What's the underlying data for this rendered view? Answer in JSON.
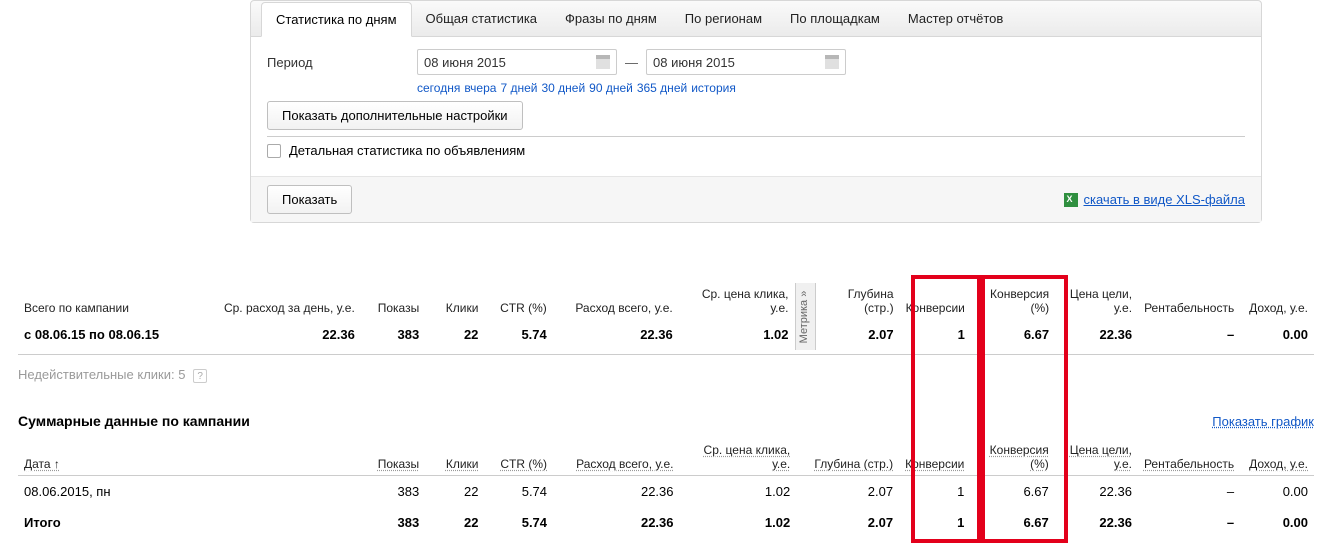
{
  "tabs": {
    "t0": "Статистика по дням",
    "t1": "Общая статистика",
    "t2": "Фразы по дням",
    "t3": "По регионам",
    "t4": "По площадкам",
    "t5": "Мастер отчётов"
  },
  "period": {
    "label": "Период",
    "from": "08 июня 2015",
    "to": "08 июня 2015"
  },
  "quick": {
    "today": "сегодня",
    "yesterday": "вчера",
    "d7": "7 дней",
    "d30": "30 дней",
    "d90": "90 дней",
    "d365": "365 дней",
    "history": "история"
  },
  "buttons": {
    "more_settings": "Показать дополнительные настройки",
    "detailed_checkbox": "Детальная статистика по объявлениям",
    "show": "Показать"
  },
  "xls": {
    "label": "скачать в виде XLS-файла"
  },
  "summary": {
    "row_label": "Всего по кампании",
    "range": "с 08.06.15 по 08.06.15",
    "headers": {
      "avg_spend_day": "Ср. расход за день, у.е.",
      "shows": "Показы",
      "clicks": "Клики",
      "ctr": "CTR (%)",
      "spend_total": "Расход всего, у.е.",
      "avg_cpc": "Ср. цена клика, у.е.",
      "metrica": "Метрика »",
      "depth": "Глубина (стр.)",
      "conversions": "Конверсии",
      "conv_pct": "Конверсия (%)",
      "goal_price": "Цена цели, у.е.",
      "roi": "Рентабельность",
      "revenue": "Доход, у.е."
    },
    "vals": {
      "avg_spend_day": "22.36",
      "shows": "383",
      "clicks": "22",
      "ctr": "5.74",
      "spend_total": "22.36",
      "avg_cpc": "1.02",
      "depth": "2.07",
      "conversions": "1",
      "conv_pct": "6.67",
      "goal_price": "22.36",
      "roi": "–",
      "revenue": "0.00"
    }
  },
  "invalid_clicks": {
    "label": "Недействительные клики:",
    "value": "5"
  },
  "detail": {
    "title": "Суммарные данные по кампании",
    "show_chart": "Показать график",
    "headers": {
      "date": "Дата ↑",
      "shows": "Показы",
      "clicks": "Клики",
      "ctr": "CTR (%)",
      "spend_total": "Расход всего, у.е.",
      "avg_cpc": "Ср. цена клика, у.е.",
      "depth": "Глубина (стр.)",
      "conversions": "Конверсии",
      "conv_pct": "Конверсия (%)",
      "goal_price": "Цена цели, у.е.",
      "roi": "Рентабельность",
      "revenue": "Доход, у.е."
    },
    "row": {
      "date": "08.06.2015, пн",
      "shows": "383",
      "clicks": "22",
      "ctr": "5.74",
      "spend_total": "22.36",
      "avg_cpc": "1.02",
      "depth": "2.07",
      "conversions": "1",
      "conv_pct": "6.67",
      "goal_price": "22.36",
      "roi": "–",
      "revenue": "0.00"
    },
    "totals_label": "Итого",
    "totals": {
      "shows": "383",
      "clicks": "22",
      "ctr": "5.74",
      "spend_total": "22.36",
      "avg_cpc": "1.02",
      "depth": "2.07",
      "conversions": "1",
      "conv_pct": "6.67",
      "goal_price": "22.36",
      "roi": "–",
      "revenue": "0.00"
    }
  }
}
